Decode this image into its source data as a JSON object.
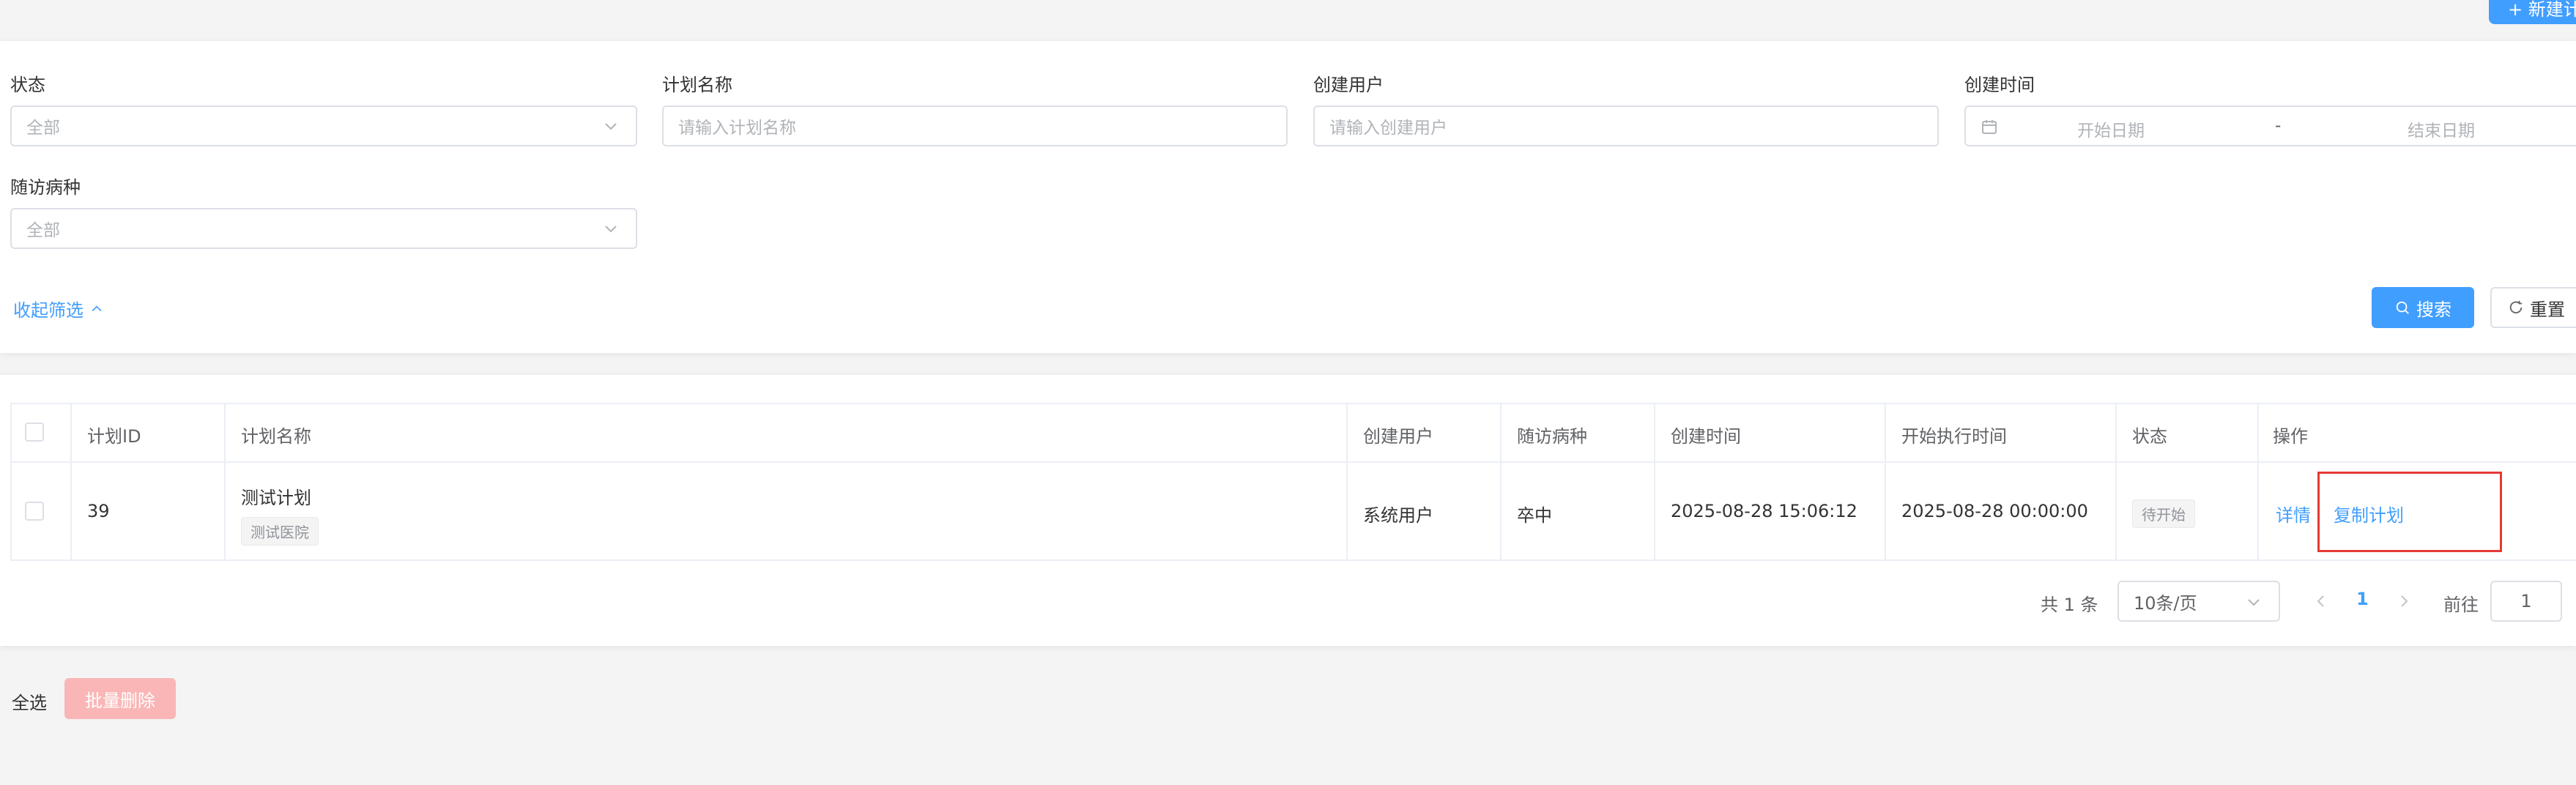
{
  "header": {
    "new_button_label": "+ 新建计"
  },
  "filters": {
    "status": {
      "label": "状态",
      "value": "全部"
    },
    "plan_name": {
      "label": "计划名称",
      "placeholder": "请输入计划名称"
    },
    "creator": {
      "label": "创建用户",
      "placeholder": "请输入创建用户"
    },
    "created_time": {
      "label": "创建时间",
      "start_placeholder": "开始日期",
      "separator": "-",
      "end_placeholder": "结束日期"
    },
    "disease": {
      "label": "随访病种",
      "value": "全部"
    },
    "collapse_label": "收起筛选",
    "search_label": "搜索",
    "reset_label": "重置"
  },
  "table": {
    "columns": [
      "计划ID",
      "计划名称",
      "创建用户",
      "随访病种",
      "创建时间",
      "开始执行时间",
      "状态",
      "操作"
    ],
    "rows": [
      {
        "id": "39",
        "name": "测试计划",
        "hospital_tag": "测试医院",
        "creator": "系统用户",
        "disease": "卒中",
        "created_time": "2025-08-28 15:06:12",
        "start_time": "2025-08-28 00:00:00",
        "status": "待开始",
        "actions": {
          "detail": "详情",
          "copy": "复制计划"
        }
      }
    ]
  },
  "pagination": {
    "total": "共 1 条",
    "page_size": "10条/页",
    "current_page": "1",
    "goto_label": "前往",
    "goto_value": "1"
  },
  "footer": {
    "select_all": "全选",
    "bulk_delete": "批量删除"
  },
  "colors": {
    "primary": "#409eff",
    "danger_light": "#fab6b6",
    "highlight": "#e53935"
  }
}
